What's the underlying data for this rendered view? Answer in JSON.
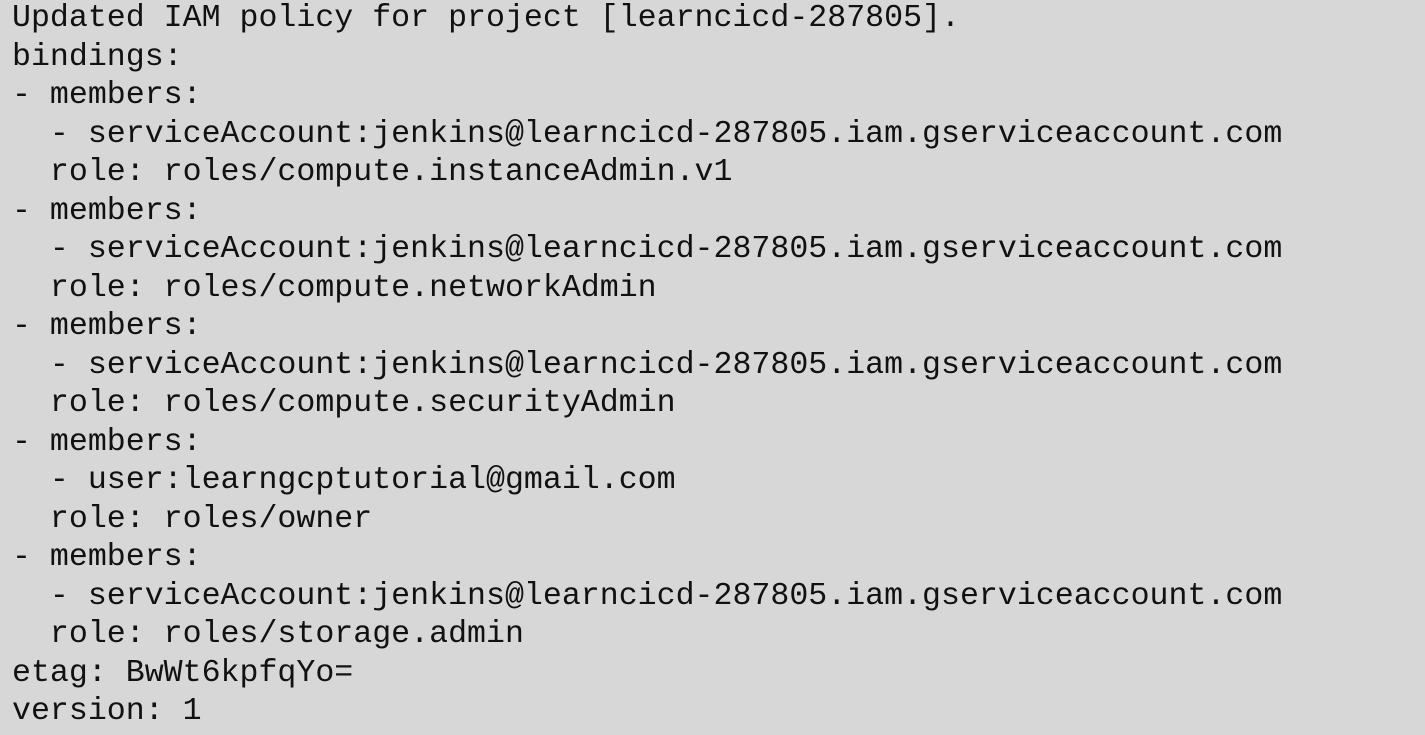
{
  "terminal": {
    "lines": [
      "Updated IAM policy for project [learncicd-287805].",
      "bindings:",
      "- members:",
      "  - serviceAccount:jenkins@learncicd-287805.iam.gserviceaccount.com",
      "  role: roles/compute.instanceAdmin.v1",
      "- members:",
      "  - serviceAccount:jenkins@learncicd-287805.iam.gserviceaccount.com",
      "  role: roles/compute.networkAdmin",
      "- members:",
      "  - serviceAccount:jenkins@learncicd-287805.iam.gserviceaccount.com",
      "  role: roles/compute.securityAdmin",
      "- members:",
      "  - user:learngcptutorial@gmail.com",
      "  role: roles/owner",
      "- members:",
      "  - serviceAccount:jenkins@learncicd-287805.iam.gserviceaccount.com",
      "  role: roles/storage.admin",
      "etag: BwWt6kpfqYo=",
      "version: 1"
    ]
  },
  "colors": {
    "background": "#d7d7d7",
    "text": "#111111"
  }
}
